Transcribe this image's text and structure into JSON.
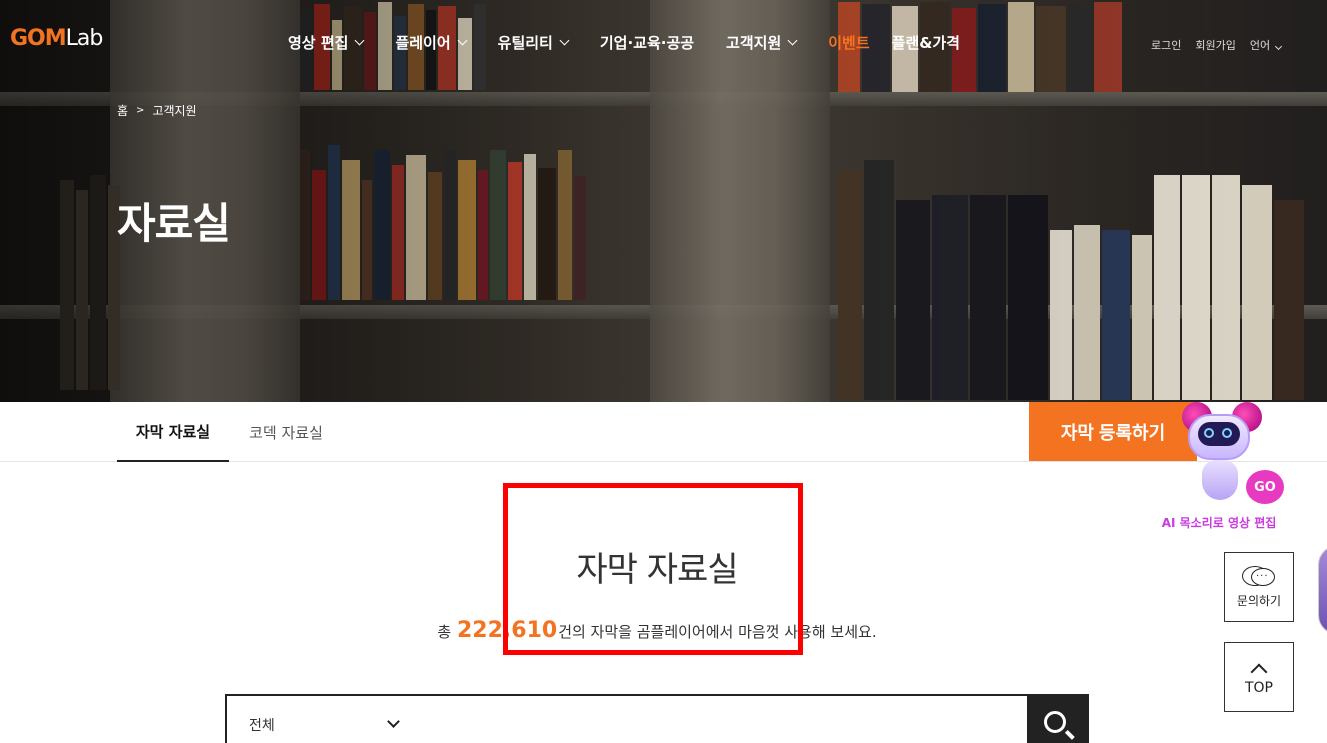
{
  "header": {
    "logo": {
      "gom": "GOM",
      "lab": "Lab"
    },
    "nav": [
      {
        "label": "영상 편집",
        "has_dropdown": true
      },
      {
        "label": "플레이어",
        "has_dropdown": true
      },
      {
        "label": "유틸리티",
        "has_dropdown": true
      },
      {
        "label": "기업·교육·공공",
        "has_dropdown": false
      },
      {
        "label": "고객지원",
        "has_dropdown": true
      },
      {
        "label": "이벤트",
        "has_dropdown": false
      },
      {
        "label": "플랜&가격",
        "has_dropdown": false
      }
    ],
    "util": {
      "login": "로그인",
      "signup": "회원가입",
      "language": "언어"
    }
  },
  "hero": {
    "breadcrumb": {
      "home": "홈",
      "separator": ">",
      "current": "고객지원"
    },
    "title": "자료실"
  },
  "tabs": [
    {
      "label": "자막 자료실",
      "active": true
    },
    {
      "label": "코덱 자료실",
      "active": false
    }
  ],
  "register_button": "자막 등록하기",
  "ai_promo": {
    "go": "GO",
    "label": "AI 목소리로 영상 편집"
  },
  "main": {
    "heading": "자막 자료실",
    "total_prefix": "총",
    "total_count": "222,610",
    "total_suffix": "건의 자막을 곰플레이어에서 마음껏 사용해 보세요."
  },
  "search": {
    "category_selected": "전체"
  },
  "floating": {
    "inquiry": "문의하기",
    "top": "TOP"
  },
  "colors": {
    "accent": "#f37321",
    "highlight_box": "#ff0000",
    "ai_pink": "#e83ac0"
  }
}
